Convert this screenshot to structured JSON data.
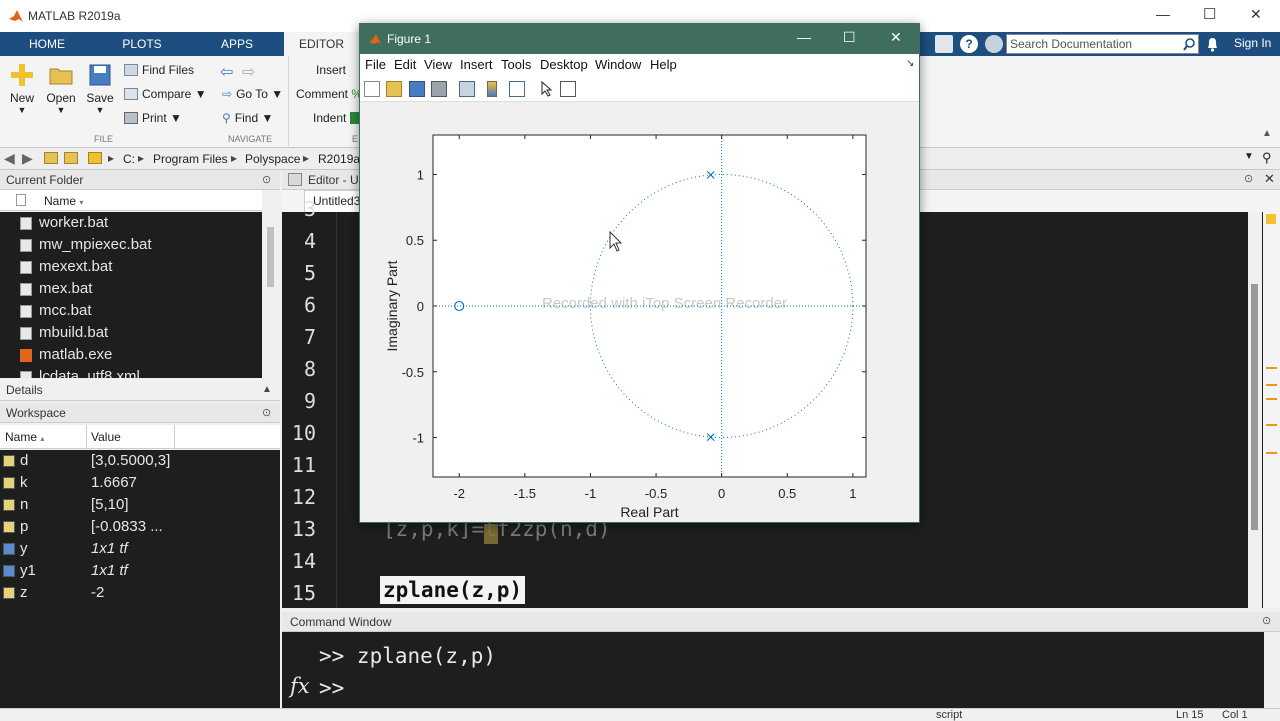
{
  "app": {
    "title": "MATLAB R2019a"
  },
  "window_controls": {
    "minimize": "—",
    "maximize": "☐",
    "close": "✕"
  },
  "tabs": [
    {
      "label": "HOME"
    },
    {
      "label": "PLOTS"
    },
    {
      "label": "APPS"
    },
    {
      "label": "EDITOR"
    }
  ],
  "search": {
    "placeholder": "Search Documentation",
    "signin": "Sign In"
  },
  "ribbon": {
    "new": "New",
    "open": "Open",
    "save": "Save",
    "find_files": "Find Files",
    "compare": "Compare",
    "print": "Print",
    "go_to": "Go To",
    "find": "Find",
    "insert": "Insert",
    "comment": "Comment",
    "indent": "Indent",
    "group_file": "FILE",
    "group_navigate": "NAVIGATE",
    "group_edit_stub": "E"
  },
  "address": {
    "path": [
      "C:",
      "Program Files",
      "Polyspace",
      "R2019a"
    ]
  },
  "current_folder": {
    "title": "Current Folder",
    "col_name": "Name",
    "files": [
      "worker.bat",
      "mw_mpiexec.bat",
      "mexext.bat",
      "mex.bat",
      "mcc.bat",
      "mbuild.bat",
      "matlab.exe",
      "lcdata_utf8.xml"
    ]
  },
  "details": {
    "title": "Details"
  },
  "workspace": {
    "title": "Workspace",
    "col_name": "Name",
    "col_value": "Value",
    "vars": [
      {
        "name": "d",
        "value": "[3,0.5000,3]",
        "icon": "matrix-icon"
      },
      {
        "name": "k",
        "value": "1.6667",
        "icon": "matrix-icon"
      },
      {
        "name": "n",
        "value": "[5,10]",
        "icon": "matrix-icon"
      },
      {
        "name": "p",
        "value": "[-0.0833 ...",
        "icon": "matrix-icon"
      },
      {
        "name": "y",
        "value": "1x1 tf",
        "icon": "object-icon"
      },
      {
        "name": "y1",
        "value": "1x1 tf",
        "icon": "object-icon"
      },
      {
        "name": "z",
        "value": "-2",
        "icon": "matrix-icon"
      }
    ]
  },
  "editor": {
    "title": "Editor - U",
    "tab": "Untitled3",
    "line_numbers": [
      "3",
      "4",
      "5",
      "6",
      "7",
      "8",
      "9",
      "10",
      "11",
      "12",
      "13",
      "14",
      "15"
    ],
    "line13_code": "[z,p,k]=tf2zp(n,d)",
    "line15_code": "zplane(z,p)"
  },
  "command_window": {
    "title": "Command Window",
    "line1": ">> zplane(z,p)",
    "prompt": ">>",
    "fx": "fx"
  },
  "status": {
    "mode": "script",
    "ln": "Ln  15",
    "col": "Col  1"
  },
  "figure": {
    "title": "Figure 1",
    "menu": [
      "File",
      "Edit",
      "View",
      "Insert",
      "Tools",
      "Desktop",
      "Window",
      "Help"
    ],
    "watermark": "Recorded with iTop Screen Recorder"
  },
  "chart_data": {
    "type": "scatter",
    "xlabel": "Real Part",
    "ylabel": "Imaginary Part",
    "xlim": [
      -2.2,
      1.1
    ],
    "ylim": [
      -1.3,
      1.3
    ],
    "xticks": [
      "-2",
      "-1.5",
      "-1",
      "-0.5",
      "0",
      "0.5",
      "1"
    ],
    "xtick_values": [
      -2,
      -1.5,
      -1,
      -0.5,
      0,
      0.5,
      1
    ],
    "yticks": [
      "1",
      "0.5",
      "0",
      "-0.5",
      "-1"
    ],
    "ytick_values": [
      1,
      0.5,
      0,
      -0.5,
      -1
    ],
    "zeros": [
      {
        "x": -2,
        "y": 0
      }
    ],
    "poles": [
      {
        "x": -0.0833,
        "y": 0.9965
      },
      {
        "x": -0.0833,
        "y": -0.9965
      }
    ],
    "unit_circle": true,
    "grid": false,
    "color": "#0072bd"
  }
}
